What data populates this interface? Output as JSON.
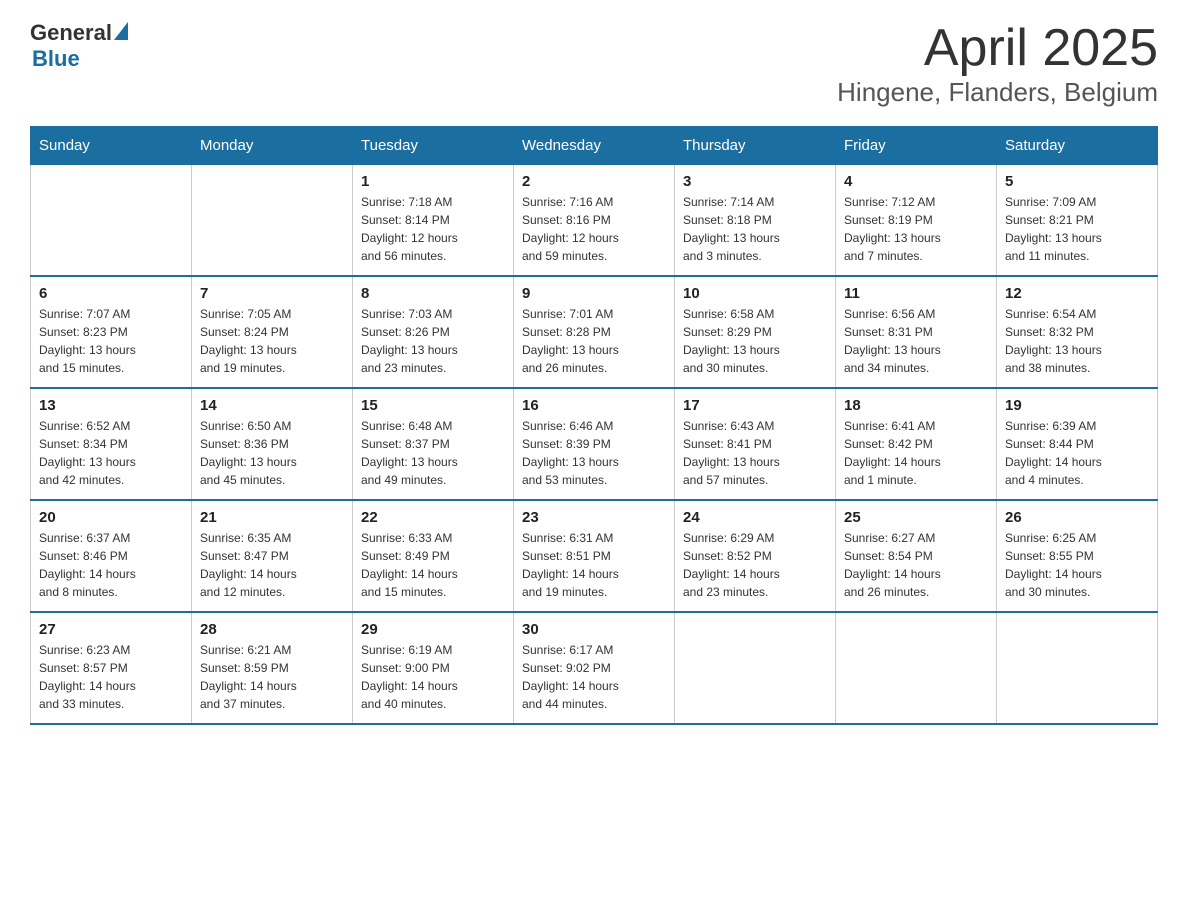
{
  "logo": {
    "general": "General",
    "blue": "Blue"
  },
  "title": "April 2025",
  "subtitle": "Hingene, Flanders, Belgium",
  "headers": [
    "Sunday",
    "Monday",
    "Tuesday",
    "Wednesday",
    "Thursday",
    "Friday",
    "Saturday"
  ],
  "weeks": [
    [
      {
        "day": "",
        "info": ""
      },
      {
        "day": "",
        "info": ""
      },
      {
        "day": "1",
        "info": "Sunrise: 7:18 AM\nSunset: 8:14 PM\nDaylight: 12 hours\nand 56 minutes."
      },
      {
        "day": "2",
        "info": "Sunrise: 7:16 AM\nSunset: 8:16 PM\nDaylight: 12 hours\nand 59 minutes."
      },
      {
        "day": "3",
        "info": "Sunrise: 7:14 AM\nSunset: 8:18 PM\nDaylight: 13 hours\nand 3 minutes."
      },
      {
        "day": "4",
        "info": "Sunrise: 7:12 AM\nSunset: 8:19 PM\nDaylight: 13 hours\nand 7 minutes."
      },
      {
        "day": "5",
        "info": "Sunrise: 7:09 AM\nSunset: 8:21 PM\nDaylight: 13 hours\nand 11 minutes."
      }
    ],
    [
      {
        "day": "6",
        "info": "Sunrise: 7:07 AM\nSunset: 8:23 PM\nDaylight: 13 hours\nand 15 minutes."
      },
      {
        "day": "7",
        "info": "Sunrise: 7:05 AM\nSunset: 8:24 PM\nDaylight: 13 hours\nand 19 minutes."
      },
      {
        "day": "8",
        "info": "Sunrise: 7:03 AM\nSunset: 8:26 PM\nDaylight: 13 hours\nand 23 minutes."
      },
      {
        "day": "9",
        "info": "Sunrise: 7:01 AM\nSunset: 8:28 PM\nDaylight: 13 hours\nand 26 minutes."
      },
      {
        "day": "10",
        "info": "Sunrise: 6:58 AM\nSunset: 8:29 PM\nDaylight: 13 hours\nand 30 minutes."
      },
      {
        "day": "11",
        "info": "Sunrise: 6:56 AM\nSunset: 8:31 PM\nDaylight: 13 hours\nand 34 minutes."
      },
      {
        "day": "12",
        "info": "Sunrise: 6:54 AM\nSunset: 8:32 PM\nDaylight: 13 hours\nand 38 minutes."
      }
    ],
    [
      {
        "day": "13",
        "info": "Sunrise: 6:52 AM\nSunset: 8:34 PM\nDaylight: 13 hours\nand 42 minutes."
      },
      {
        "day": "14",
        "info": "Sunrise: 6:50 AM\nSunset: 8:36 PM\nDaylight: 13 hours\nand 45 minutes."
      },
      {
        "day": "15",
        "info": "Sunrise: 6:48 AM\nSunset: 8:37 PM\nDaylight: 13 hours\nand 49 minutes."
      },
      {
        "day": "16",
        "info": "Sunrise: 6:46 AM\nSunset: 8:39 PM\nDaylight: 13 hours\nand 53 minutes."
      },
      {
        "day": "17",
        "info": "Sunrise: 6:43 AM\nSunset: 8:41 PM\nDaylight: 13 hours\nand 57 minutes."
      },
      {
        "day": "18",
        "info": "Sunrise: 6:41 AM\nSunset: 8:42 PM\nDaylight: 14 hours\nand 1 minute."
      },
      {
        "day": "19",
        "info": "Sunrise: 6:39 AM\nSunset: 8:44 PM\nDaylight: 14 hours\nand 4 minutes."
      }
    ],
    [
      {
        "day": "20",
        "info": "Sunrise: 6:37 AM\nSunset: 8:46 PM\nDaylight: 14 hours\nand 8 minutes."
      },
      {
        "day": "21",
        "info": "Sunrise: 6:35 AM\nSunset: 8:47 PM\nDaylight: 14 hours\nand 12 minutes."
      },
      {
        "day": "22",
        "info": "Sunrise: 6:33 AM\nSunset: 8:49 PM\nDaylight: 14 hours\nand 15 minutes."
      },
      {
        "day": "23",
        "info": "Sunrise: 6:31 AM\nSunset: 8:51 PM\nDaylight: 14 hours\nand 19 minutes."
      },
      {
        "day": "24",
        "info": "Sunrise: 6:29 AM\nSunset: 8:52 PM\nDaylight: 14 hours\nand 23 minutes."
      },
      {
        "day": "25",
        "info": "Sunrise: 6:27 AM\nSunset: 8:54 PM\nDaylight: 14 hours\nand 26 minutes."
      },
      {
        "day": "26",
        "info": "Sunrise: 6:25 AM\nSunset: 8:55 PM\nDaylight: 14 hours\nand 30 minutes."
      }
    ],
    [
      {
        "day": "27",
        "info": "Sunrise: 6:23 AM\nSunset: 8:57 PM\nDaylight: 14 hours\nand 33 minutes."
      },
      {
        "day": "28",
        "info": "Sunrise: 6:21 AM\nSunset: 8:59 PM\nDaylight: 14 hours\nand 37 minutes."
      },
      {
        "day": "29",
        "info": "Sunrise: 6:19 AM\nSunset: 9:00 PM\nDaylight: 14 hours\nand 40 minutes."
      },
      {
        "day": "30",
        "info": "Sunrise: 6:17 AM\nSunset: 9:02 PM\nDaylight: 14 hours\nand 44 minutes."
      },
      {
        "day": "",
        "info": ""
      },
      {
        "day": "",
        "info": ""
      },
      {
        "day": "",
        "info": ""
      }
    ]
  ]
}
